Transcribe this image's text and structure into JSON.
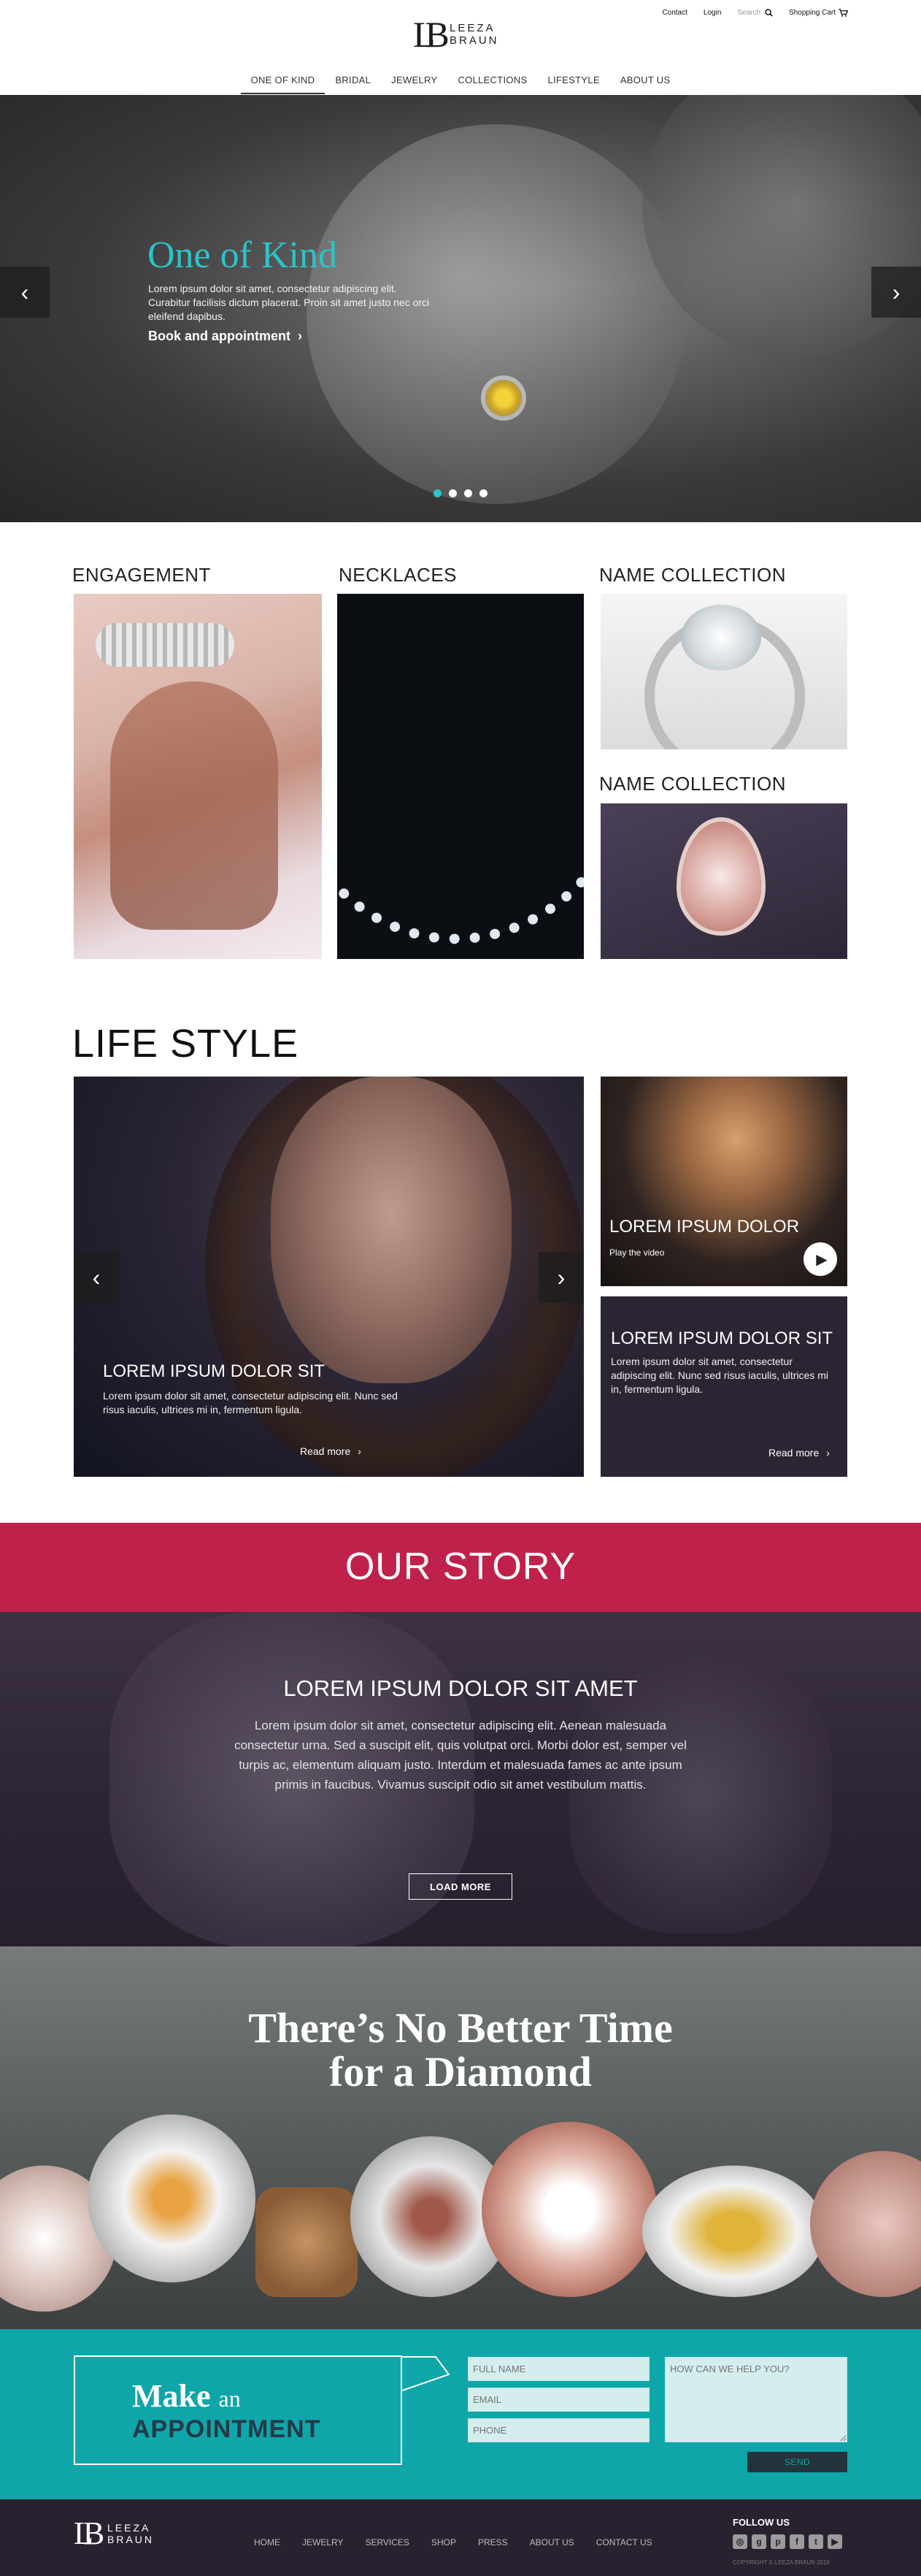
{
  "brand": {
    "mark": "LB",
    "line1": "LEEZA",
    "line2": "BRAUN"
  },
  "utility": {
    "contact": "Contact",
    "login": "Login",
    "search_placeholder": "Search",
    "cart": "Shopping Cart"
  },
  "nav": [
    "ONE OF KIND",
    "BRIDAL",
    "JEWELRY",
    "COLLECTIONS",
    "LIFESTYLE",
    "ABOUT US"
  ],
  "hero": {
    "title": "One of Kind",
    "text": "Lorem ipsum dolor sit amet, consectetur adipiscing elit. Curabitur facilisis dictum placerat. Proin sit amet justo nec orci eleifend dapibus.",
    "cta": "Book and appointment",
    "slides": 4,
    "active_slide": 1
  },
  "collections": {
    "engagement": "ENGAGEMENT",
    "necklaces": "NECKLACES",
    "name1": "NAME COLLECTION",
    "name2": "NAME COLLECTION"
  },
  "lifestyle": {
    "title": "LIFE STYLE",
    "main": {
      "title": "LOREM IPSUM DOLOR SIT",
      "text": "Lorem ipsum dolor sit amet, consectetur adipiscing elit. Nunc sed risus iaculis, ultrices mi in, fermentum ligula.",
      "readmore": "Read more"
    },
    "video": {
      "title": "LOREM IPSUM DOLOR",
      "sub": "Play the video"
    },
    "card": {
      "title": "LOREM IPSUM DOLOR SIT",
      "text": "Lorem ipsum dolor sit amet, consectetur adipiscing elit. Nunc sed risus iaculis, ultrices mi in, fermentum ligula.",
      "readmore": "Read more"
    }
  },
  "story": {
    "bar_title": "OUR STORY",
    "title": "LOREM IPSUM DOLOR SIT AMET",
    "text": "Lorem ipsum dolor sit amet, consectetur adipiscing elit. Aenean malesuada consectetur urna. Sed a suscipit elit, quis volutpat orci. Morbi dolor est, semper vel turpis ac, elementum aliquam justo. Interdum et malesuada fames ac ante ipsum primis in faucibus. Vivamus suscipit odio sit amet vestibulum mattis.",
    "button": "LOAD MORE"
  },
  "diamond": {
    "line1": "There’s No Better Time",
    "line2": "for a Diamond"
  },
  "appointment": {
    "make": "Make",
    "an": "an",
    "appointment": "APPOINTMENT",
    "full_name": "FULL NAME",
    "email": "EMAIL",
    "phone": "PHONE",
    "message": "HOW CAN WE HELP YOU?",
    "send": "SEND"
  },
  "footer": {
    "nav": [
      "HOME",
      "JEWELRY",
      "SERVICES",
      "SHOP",
      "PRESS",
      "ABOUT US",
      "CONTACT US"
    ],
    "follow": "FOLLOW US",
    "social": [
      "instagram-icon",
      "googleplus-icon",
      "pinterest-icon",
      "facebook-icon",
      "twitter-icon",
      "youtube-icon"
    ],
    "copyright": "COPYRIGHT © LEEZA BRAUN 2016"
  },
  "colors": {
    "accent": "#2bc4c8",
    "story_bar": "#c0214b",
    "appointment_bg": "#0fa6a9",
    "footer_bg": "#29212f"
  }
}
